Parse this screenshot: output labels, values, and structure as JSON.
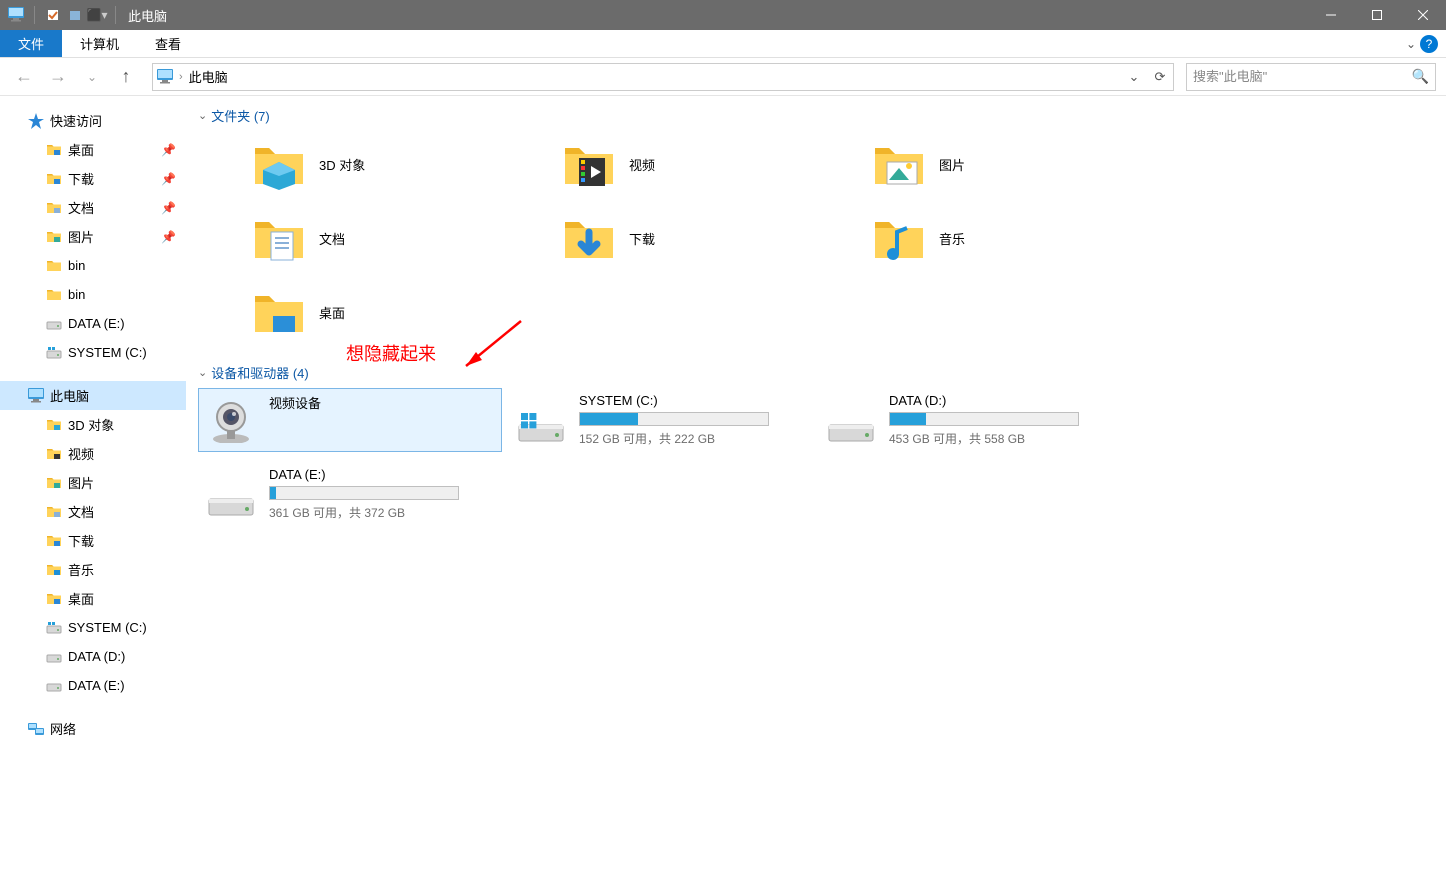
{
  "window": {
    "title": "此电脑"
  },
  "ribbon": {
    "file": "文件",
    "computer": "计算机",
    "view": "查看"
  },
  "breadcrumb": {
    "root": "此电脑"
  },
  "search": {
    "placeholder": "搜索\"此电脑\""
  },
  "sidebar": {
    "quick_access": "快速访问",
    "qa_items": [
      {
        "label": "桌面",
        "icon": "desktop",
        "pinned": true
      },
      {
        "label": "下载",
        "icon": "downloads",
        "pinned": true
      },
      {
        "label": "文档",
        "icon": "documents",
        "pinned": true
      },
      {
        "label": "图片",
        "icon": "pictures",
        "pinned": true
      },
      {
        "label": "bin",
        "icon": "folder",
        "pinned": false
      },
      {
        "label": "bin",
        "icon": "folder",
        "pinned": false
      },
      {
        "label": "DATA (E:)",
        "icon": "drive",
        "pinned": false
      },
      {
        "label": "SYSTEM (C:)",
        "icon": "drive-win",
        "pinned": false
      }
    ],
    "this_pc": "此电脑",
    "pc_items": [
      {
        "label": "3D 对象",
        "icon": "folder-3d"
      },
      {
        "label": "视频",
        "icon": "folder-video"
      },
      {
        "label": "图片",
        "icon": "folder-pictures"
      },
      {
        "label": "文档",
        "icon": "folder-documents"
      },
      {
        "label": "下载",
        "icon": "folder-downloads"
      },
      {
        "label": "音乐",
        "icon": "folder-music"
      },
      {
        "label": "桌面",
        "icon": "folder-desktop"
      },
      {
        "label": "SYSTEM (C:)",
        "icon": "drive-win"
      },
      {
        "label": "DATA (D:)",
        "icon": "drive"
      },
      {
        "label": "DATA (E:)",
        "icon": "drive"
      }
    ],
    "network": "网络"
  },
  "sections": {
    "folders": {
      "header": "文件夹 (7)"
    },
    "devices": {
      "header": "设备和驱动器 (4)"
    }
  },
  "folders": [
    {
      "label": "3D 对象"
    },
    {
      "label": "视频"
    },
    {
      "label": "图片"
    },
    {
      "label": "文档"
    },
    {
      "label": "下载"
    },
    {
      "label": "音乐"
    },
    {
      "label": "桌面"
    }
  ],
  "devices": [
    {
      "name": "视频设备",
      "type": "camera",
      "selected": true
    },
    {
      "name": "SYSTEM (C:)",
      "type": "drive-win",
      "fill_pct": 31,
      "capacity_text": "152 GB 可用，共 222 GB"
    },
    {
      "name": "DATA (D:)",
      "type": "drive",
      "fill_pct": 19,
      "capacity_text": "453 GB 可用，共 558 GB"
    },
    {
      "name": "DATA (E:)",
      "type": "drive",
      "fill_pct": 3,
      "capacity_text": "361 GB 可用，共 372 GB"
    }
  ],
  "annotation": {
    "text": "想隐藏起来"
  }
}
